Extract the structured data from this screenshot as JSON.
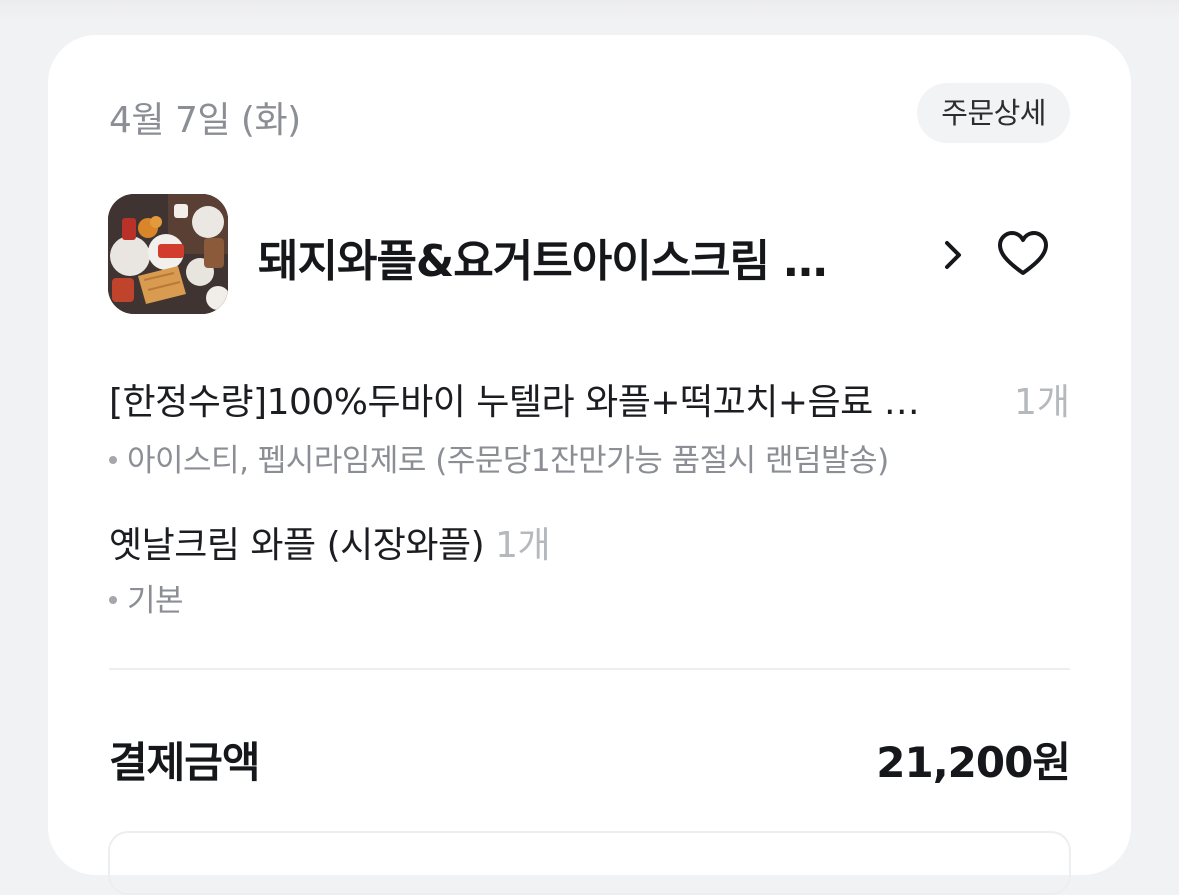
{
  "order": {
    "date": "4월 7일 (화)",
    "detail_button": "주문상세",
    "store": {
      "name": "돼지와플&요거트아이스크림 …",
      "thumbnail_icon": "store-photo"
    },
    "items": [
      {
        "name": "[한정수량]100%두바이 누텔라 와플+떡꼬치+음료 …",
        "quantity": "1개",
        "option": "아이스티, 펩시라임제로 (주문당1잔만가능 품절시 랜덤발송)"
      },
      {
        "name": "옛날크림 와플 (시장와플)",
        "quantity": "1개",
        "option": "기본"
      }
    ],
    "payment": {
      "label": "결제금액",
      "amount": "21,200원"
    }
  },
  "colors": {
    "background": "#f1f2f4",
    "card": "#ffffff",
    "muted_text": "#8b8e94",
    "quantity_text": "#b5b8bd",
    "primary_text": "#16171a"
  }
}
